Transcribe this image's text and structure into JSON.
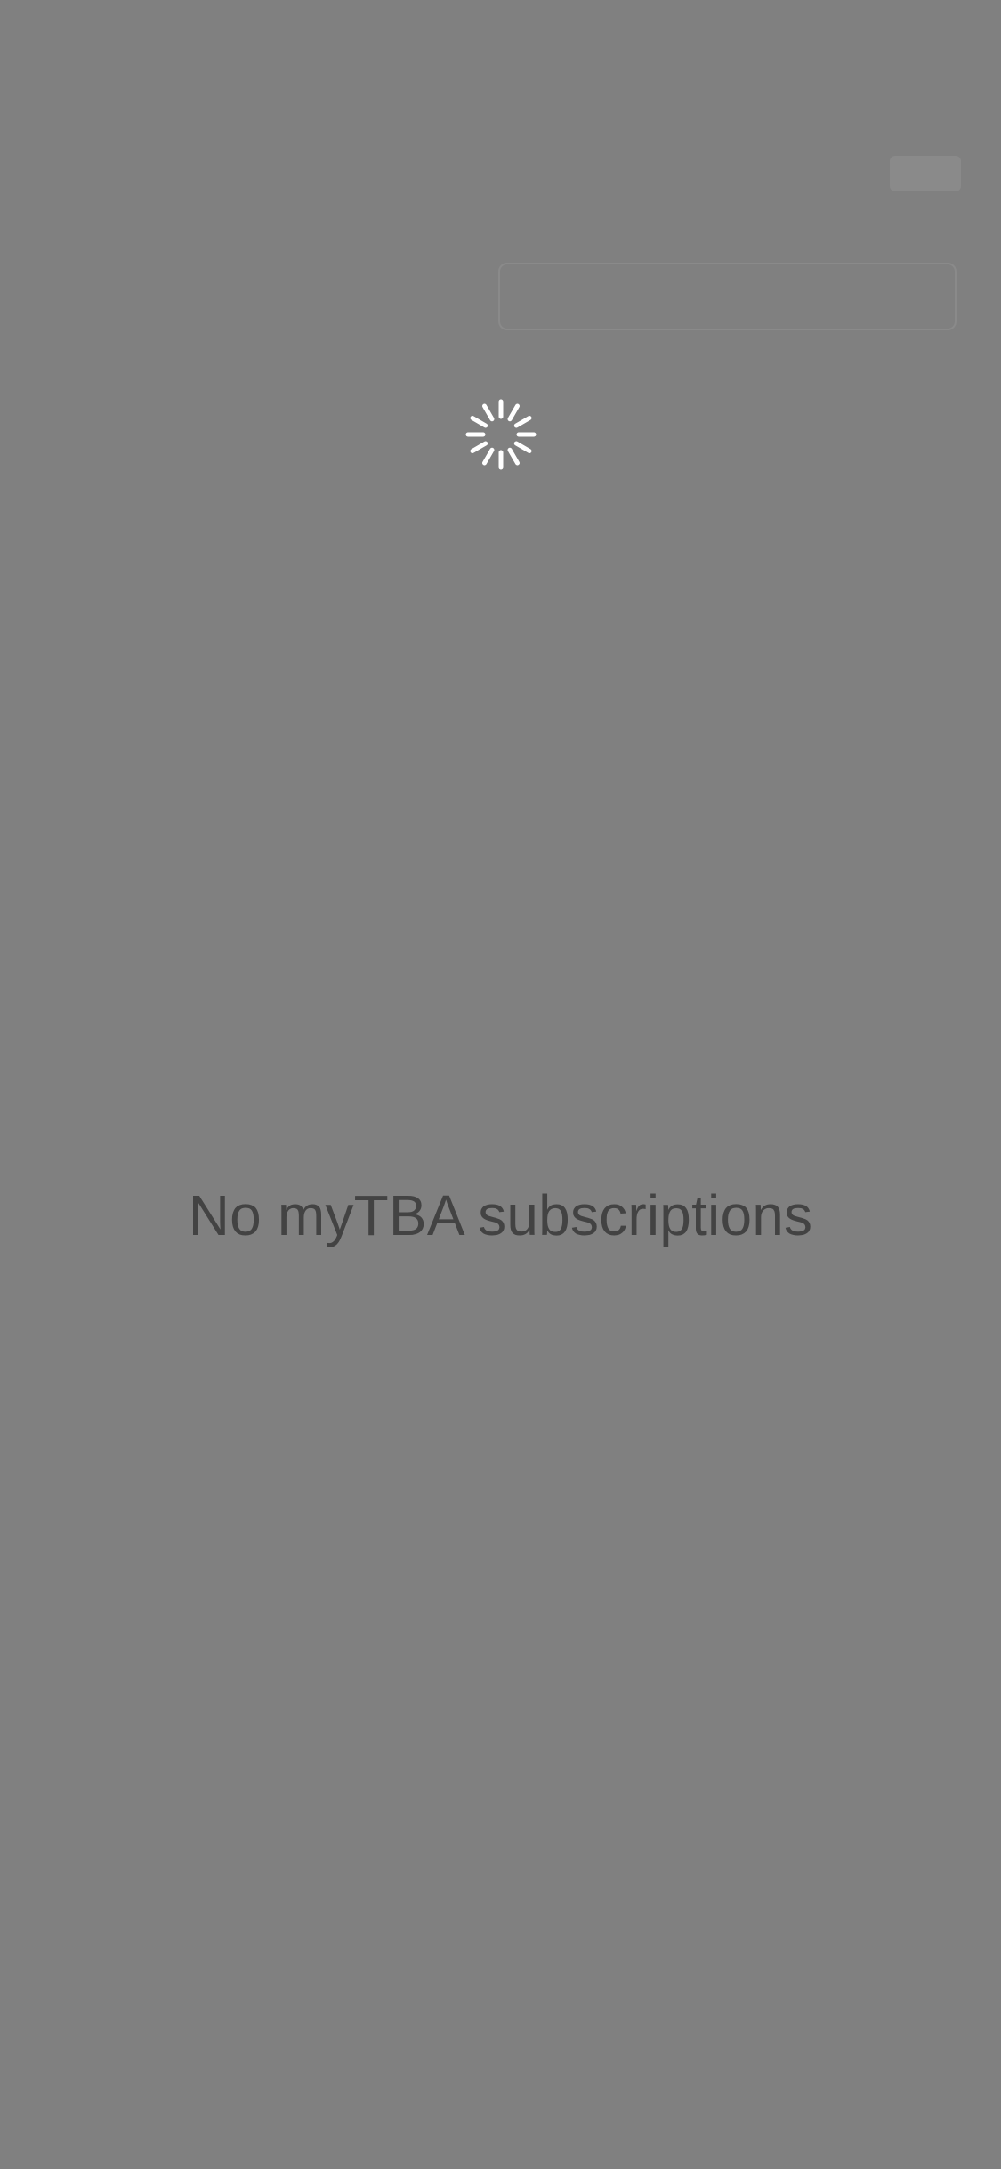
{
  "background_color": "#808080",
  "loading": {
    "icon": "spinner-icon",
    "color": "#ffffff"
  },
  "empty_state": {
    "message": "No myTBA subscriptions",
    "color": "#434343"
  }
}
